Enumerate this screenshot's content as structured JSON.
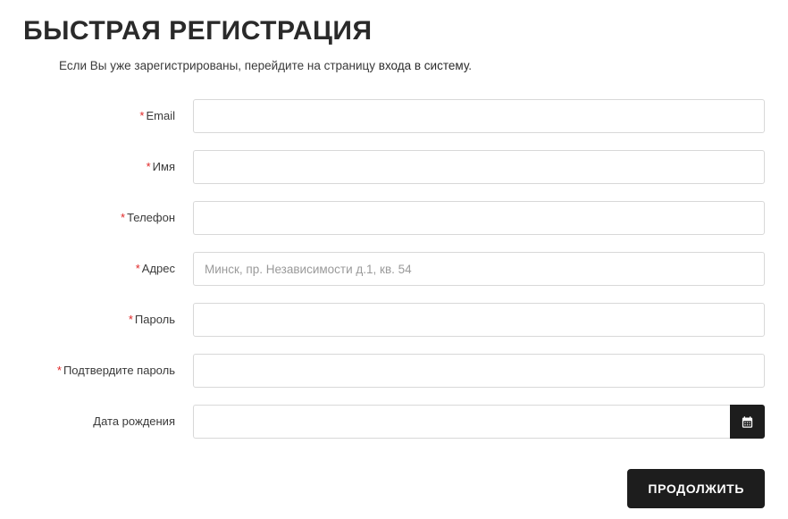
{
  "title": "БЫСТРАЯ РЕГИСТРАЦИЯ",
  "hint_prefix": "Если Вы уже зарегистрированы, перейдите на страницу ",
  "hint_link": "входа в систему",
  "hint_suffix": ".",
  "fields": {
    "email": {
      "label": "Email",
      "required": true,
      "value": "",
      "placeholder": ""
    },
    "name": {
      "label": "Имя",
      "required": true,
      "value": "",
      "placeholder": ""
    },
    "phone": {
      "label": "Телефон",
      "required": true,
      "value": "",
      "placeholder": ""
    },
    "address": {
      "label": "Адрес",
      "required": true,
      "value": "",
      "placeholder": "Минск, пр. Независимости д.1, кв. 54"
    },
    "password": {
      "label": "Пароль",
      "required": true,
      "value": "",
      "placeholder": ""
    },
    "confirm": {
      "label": "Подтвердите пароль",
      "required": true,
      "value": "",
      "placeholder": ""
    },
    "dob": {
      "label": "Дата рождения",
      "required": false,
      "value": "",
      "placeholder": ""
    }
  },
  "buttons": {
    "continue": "ПРОДОЛЖИТЬ"
  }
}
